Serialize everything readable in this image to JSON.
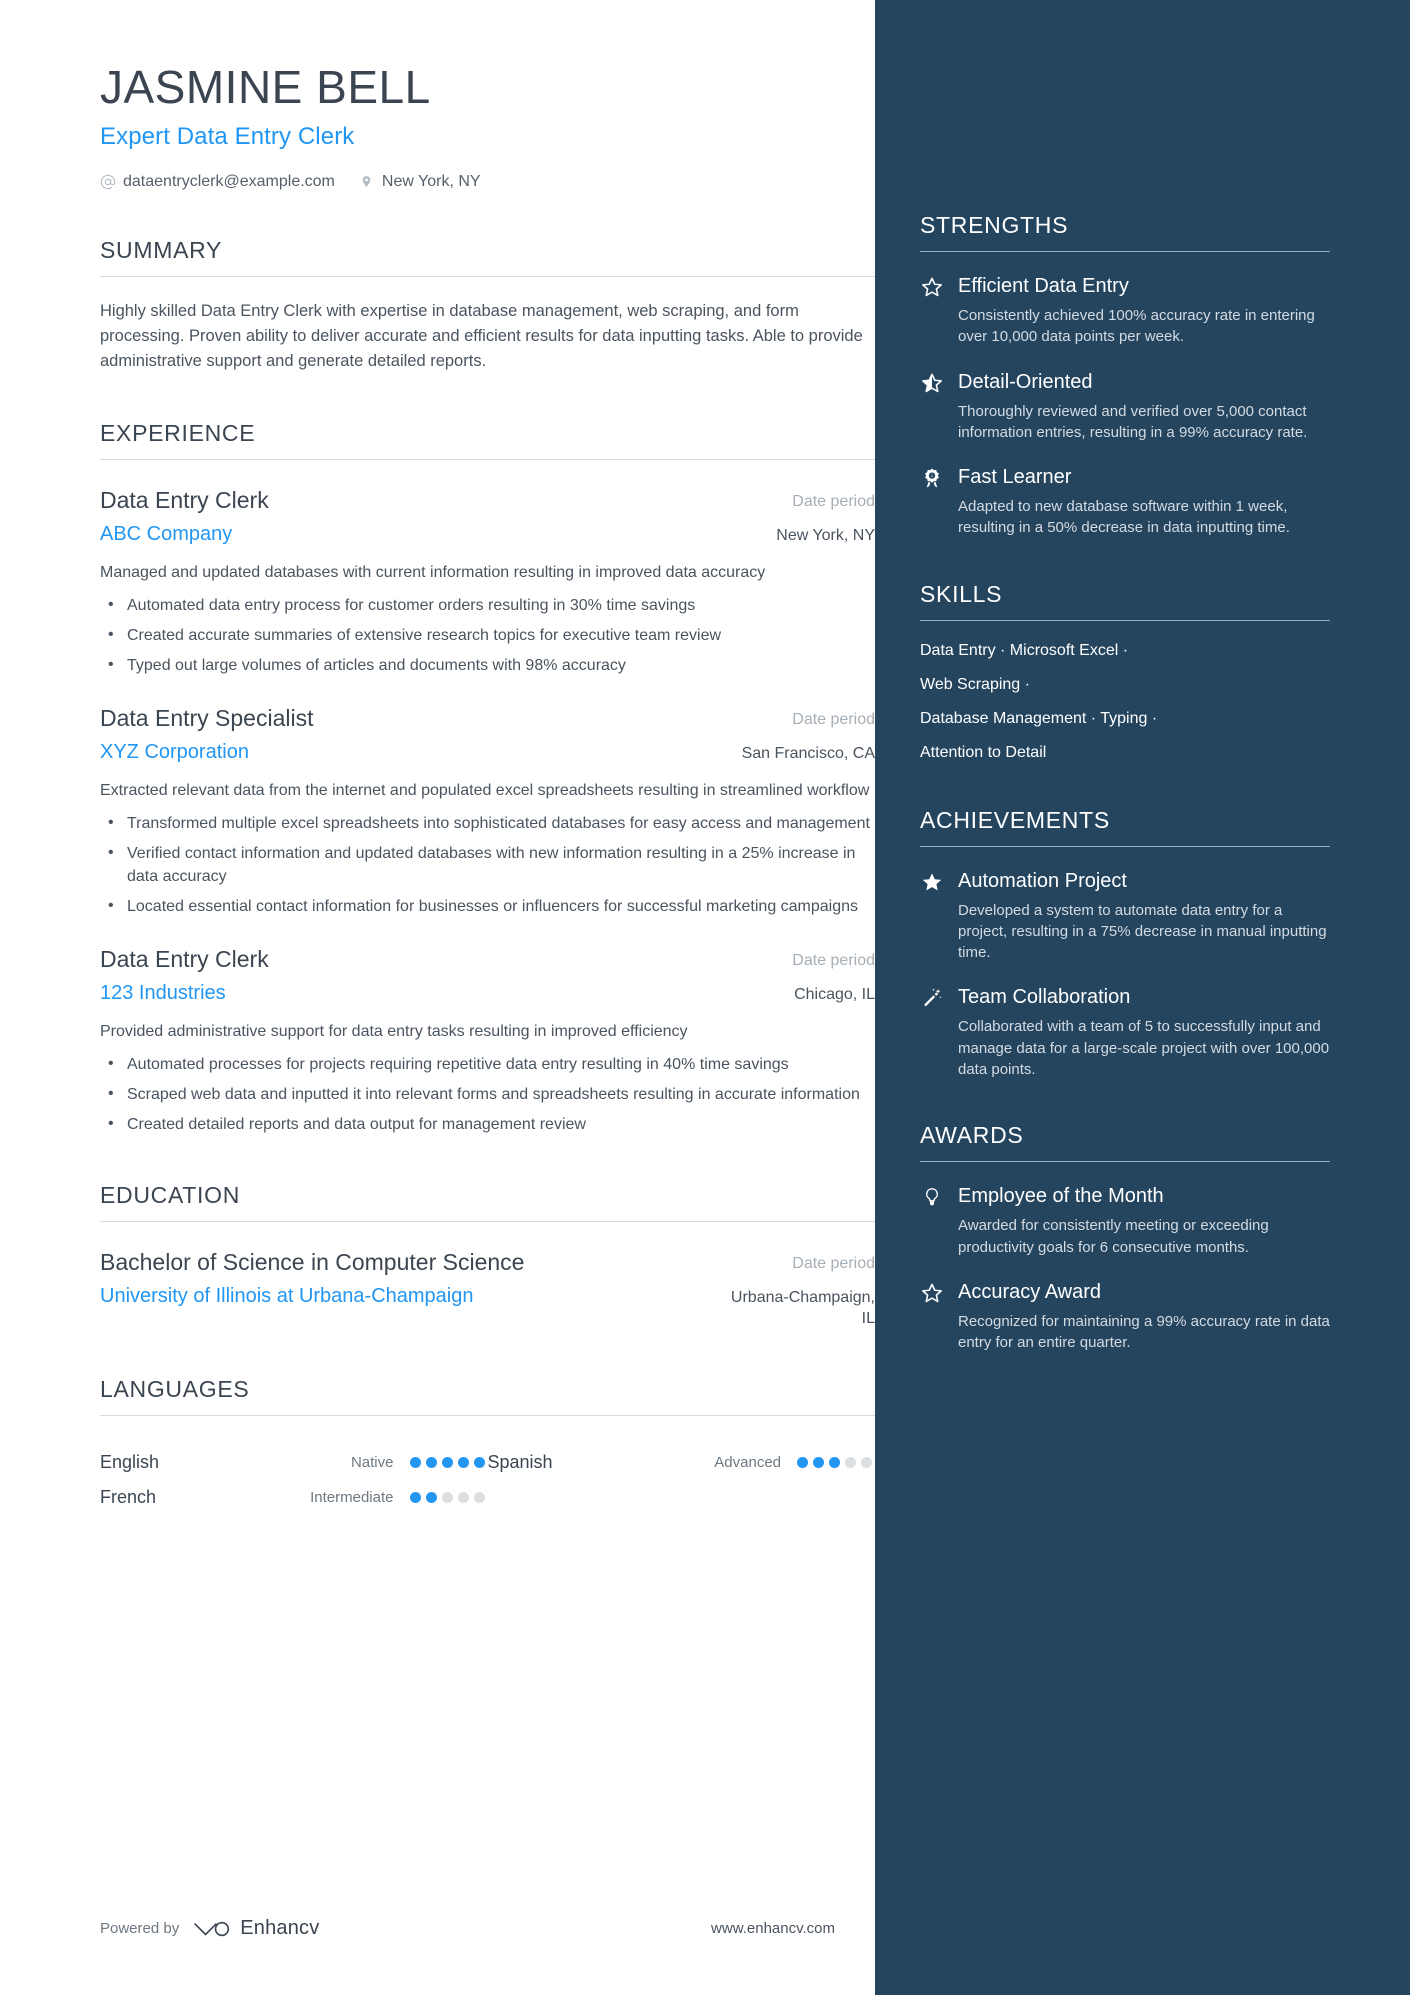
{
  "header": {
    "name": "JASMINE BELL",
    "headline": "Expert Data Entry Clerk",
    "email": "dataentryclerk@example.com",
    "location": "New York, NY"
  },
  "summary": {
    "title": "SUMMARY",
    "text": "Highly skilled Data Entry Clerk with expertise in database management, web scraping, and form processing. Proven ability to deliver accurate and efficient results for data inputting tasks. Able to provide administrative support and generate detailed reports."
  },
  "experience": {
    "title": "EXPERIENCE",
    "entries": [
      {
        "role": "Data Entry Clerk",
        "date": "Date period",
        "company": "ABC Company",
        "location": "New York, NY",
        "description": "Managed and updated databases with current information resulting in improved data accuracy",
        "bullets": [
          "Automated data entry process for customer orders resulting in 30% time savings",
          "Created accurate summaries of extensive research topics for executive team review",
          "Typed out large volumes of articles and documents with 98% accuracy"
        ]
      },
      {
        "role": "Data Entry Specialist",
        "date": "Date period",
        "company": "XYZ Corporation",
        "location": "San Francisco, CA",
        "description": "Extracted relevant data from the internet and populated excel spreadsheets resulting in streamlined workflow",
        "bullets": [
          "Transformed multiple excel spreadsheets into sophisticated databases for easy access and management",
          "Verified contact information and updated databases with new information resulting in a 25% increase in data accuracy",
          "Located essential contact information for businesses or influencers for successful marketing campaigns"
        ]
      },
      {
        "role": "Data Entry Clerk",
        "date": "Date period",
        "company": "123 Industries",
        "location": "Chicago, IL",
        "description": "Provided administrative support for data entry tasks resulting in improved efficiency",
        "bullets": [
          "Automated processes for projects requiring repetitive data entry resulting in 40% time savings",
          "Scraped web data and inputted it into relevant forms and spreadsheets resulting in accurate information",
          "Created detailed reports and data output for management review"
        ]
      }
    ]
  },
  "education": {
    "title": "EDUCATION",
    "entries": [
      {
        "degree": "Bachelor of Science in Computer Science",
        "date": "Date period",
        "school": "University of Illinois at Urbana-Champaign",
        "location": "Urbana-Champaign, IL"
      }
    ]
  },
  "languages": {
    "title": "LANGUAGES",
    "items": [
      {
        "name": "English",
        "level": "Native",
        "rating": 5,
        "max": 5
      },
      {
        "name": "Spanish",
        "level": "Advanced",
        "rating": 3,
        "max": 5
      },
      {
        "name": "French",
        "level": "Intermediate",
        "rating": 2,
        "max": 5
      }
    ]
  },
  "footer": {
    "powered_label": "Powered by",
    "brand": "Enhancv",
    "website": "www.enhancv.com"
  },
  "strengths": {
    "title": "STRENGTHS",
    "items": [
      {
        "icon": "star-outline-icon",
        "title": "Efficient Data Entry",
        "desc": "Consistently achieved 100% accuracy rate in entering over 10,000 data points per week."
      },
      {
        "icon": "star-half-icon",
        "title": "Detail-Oriented",
        "desc": "Thoroughly reviewed and verified over 5,000 contact information entries, resulting in a 99% accuracy rate."
      },
      {
        "icon": "award-medal-icon",
        "title": "Fast Learner",
        "desc": "Adapted to new database software within 1 week, resulting in a 50% decrease in data inputting time."
      }
    ]
  },
  "skills": {
    "title": "SKILLS",
    "lines": [
      "Data Entry · Microsoft Excel ·",
      "Web Scraping ·",
      "Database Management · Typing ·",
      "Attention to Detail"
    ]
  },
  "achievements": {
    "title": "ACHIEVEMENTS",
    "items": [
      {
        "icon": "star-filled-icon",
        "title": "Automation Project",
        "desc": "Developed a system to automate data entry for a project, resulting in a 75% decrease in manual inputting time."
      },
      {
        "icon": "magic-wand-icon",
        "title": "Team Collaboration",
        "desc": "Collaborated with a team of 5 to successfully input and manage data for a large-scale project with over 100,000 data points."
      }
    ]
  },
  "awards": {
    "title": "AWARDS",
    "items": [
      {
        "icon": "lightbulb-icon",
        "title": "Employee of the Month",
        "desc": "Awarded for consistently meeting or exceeding productivity goals for 6 consecutive months."
      },
      {
        "icon": "star-outline-icon",
        "title": "Accuracy Award",
        "desc": "Recognized for maintaining a 99% accuracy rate in data entry for an entire quarter."
      }
    ]
  },
  "colors": {
    "accent": "#2196f3",
    "sidebar_bg": "#25455f",
    "text": "#3b4551"
  }
}
